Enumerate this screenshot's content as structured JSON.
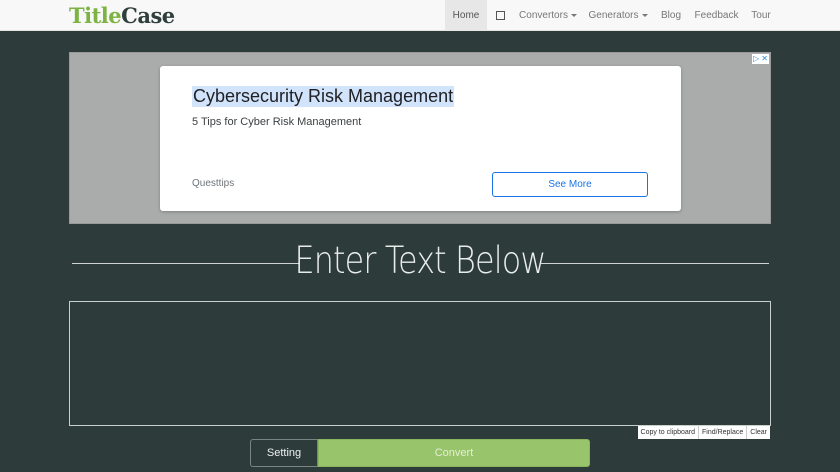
{
  "brand": {
    "part1": "Title",
    "part2": "Case"
  },
  "nav": {
    "home": "Home",
    "convertors": "Convertors",
    "generators": "Generators",
    "blog": "Blog",
    "feedback": "Feedback",
    "tour": "Tour"
  },
  "ad": {
    "title": "Cybersecurity Risk Management",
    "subtitle": "5 Tips for Cyber Risk Management",
    "source": "Questtips",
    "button": "See More"
  },
  "main": {
    "heading": "Enter Text Below",
    "editor_value": ""
  },
  "tools": {
    "copy": "Copy to clipboard",
    "find": "Find/Replace",
    "clear": "Clear"
  },
  "actions": {
    "setting": "Setting",
    "convert": "Convert"
  },
  "colors": {
    "background": "#2d3c3b",
    "accent": "#98c46b",
    "brand_green": "#7cb342"
  }
}
